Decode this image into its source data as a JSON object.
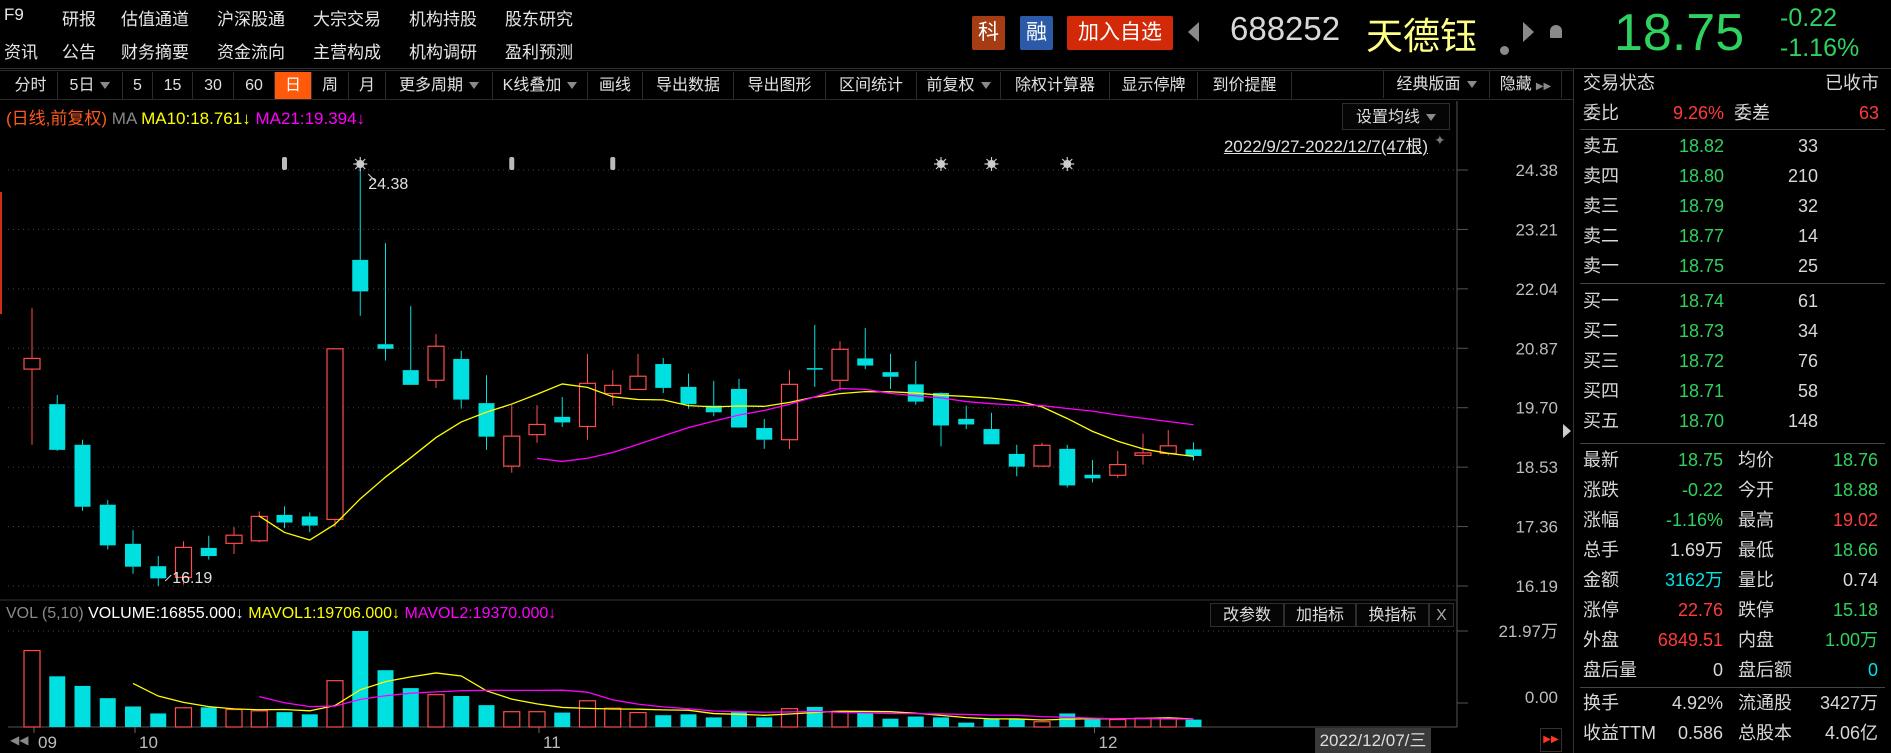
{
  "menu": {
    "row1": [
      "F9",
      "研报",
      "估值通道",
      "沪深股通",
      "大宗交易",
      "机构持股",
      "股东研究"
    ],
    "row2": [
      "资讯",
      "公告",
      "财务摘要",
      "资金流向",
      "主营构成",
      "机构调研",
      "盈利预测"
    ]
  },
  "header": {
    "badge_ke": "科",
    "badge_rong": "融",
    "add_watchlist": "加入自选",
    "code": "688252",
    "name": "天德钰",
    "price": "18.75",
    "change": "-0.22",
    "change_pct": "-1.16%"
  },
  "toolbar": {
    "items": [
      "分时",
      "5日",
      "5",
      "15",
      "30",
      "60",
      "日",
      "周",
      "月",
      "更多周期",
      "K线叠加",
      "画线",
      "导出数据",
      "导出图形",
      "区间统计",
      "前复权",
      "除权计算器",
      "显示停牌",
      "到价提醒"
    ],
    "selected": "日",
    "layout": "经典版面",
    "hide": "隐藏"
  },
  "chart_legend": {
    "mode": "(日线,前复权)",
    "ma": "MA",
    "ma10": "MA10:18.761↓",
    "ma21": "MA21:19.394↓"
  },
  "chart_controls": {
    "set_ma": "设置均线",
    "range": "2022/9/27-2022/12/7(47根)"
  },
  "volume_legend": {
    "name": "VOL (5,10)",
    "volume": "VOLUME:16855.000↓",
    "mavol1": "MAVOL1:19706.000↓",
    "mavol2": "MAVOL2:19370.000↓",
    "buttons": [
      "改参数",
      "加指标",
      "换指标",
      "X"
    ]
  },
  "colors": {
    "up": "#ff4c4c",
    "down": "#00e0e0",
    "ma10": "#ffff00",
    "ma21": "#ff00ff",
    "green": "#2fd15f",
    "red": "#ff3b3b"
  },
  "chart_data": {
    "type": "candlestick",
    "title": "688252 天德钰 日线 前复权",
    "price_ticks": [
      "24.38",
      "23.21",
      "22.04",
      "20.87",
      "19.70",
      "18.53",
      "17.36",
      "16.19"
    ],
    "ylim": [
      16.19,
      24.38
    ],
    "annotations": {
      "high": "24.38",
      "low": "16.19",
      "high_index": 13,
      "low_index": 5
    },
    "event_markers": [
      {
        "index": 10,
        "type": "info"
      },
      {
        "index": 13,
        "type": "star"
      },
      {
        "index": 19,
        "type": "info"
      },
      {
        "index": 23,
        "type": "info"
      },
      {
        "index": 36,
        "type": "star"
      },
      {
        "index": 38,
        "type": "star"
      },
      {
        "index": 41,
        "type": "star"
      }
    ],
    "month_labels": [
      {
        "index": 0,
        "label": "09"
      },
      {
        "index": 4,
        "label": "10"
      },
      {
        "index": 20,
        "label": "11"
      },
      {
        "index": 42,
        "label": "12"
      }
    ],
    "open": [
      20.46,
      19.77,
      18.97,
      17.79,
      17.02,
      16.58,
      16.36,
      16.94,
      17.03,
      17.08,
      17.59,
      17.56,
      17.5,
      22.61,
      20.95,
      20.44,
      20.24,
      20.66,
      19.79,
      18.55,
      19.17,
      19.52,
      19.33,
      19.98,
      20.06,
      20.56,
      20.11,
      19.74,
      20.07,
      19.3,
      19.07,
      20.48,
      20.24,
      20.67,
      20.4,
      20.16,
      19.99,
      19.48,
      19.28,
      18.79,
      18.55,
      18.89,
      18.38,
      18.37,
      18.76,
      18.8,
      18.88
    ],
    "high": [
      21.66,
      19.95,
      19.07,
      17.88,
      17.29,
      16.78,
      17.07,
      17.18,
      17.35,
      17.66,
      17.76,
      17.64,
      20.86,
      24.38,
      22.94,
      21.7,
      21.15,
      20.82,
      20.34,
      19.75,
      19.75,
      19.91,
      20.76,
      20.44,
      20.76,
      20.68,
      20.37,
      20.23,
      20.27,
      19.48,
      20.44,
      21.33,
      21.01,
      21.27,
      20.76,
      20.62,
      20.0,
      19.74,
      19.6,
      18.97,
      19.01,
      18.97,
      18.67,
      18.85,
      19.19,
      19.26,
      19.02
    ],
    "low": [
      18.97,
      18.85,
      17.67,
      16.91,
      16.43,
      16.19,
      16.22,
      16.71,
      16.82,
      17.05,
      17.33,
      17.25,
      17.35,
      21.51,
      20.63,
      20.15,
      20.09,
      19.68,
      18.87,
      18.42,
      19.01,
      19.32,
      19.07,
      19.74,
      20.06,
      19.99,
      19.68,
      19.53,
      19.31,
      18.89,
      18.89,
      20.11,
      20.04,
      20.46,
      20.07,
      19.76,
      18.94,
      19.28,
      18.98,
      18.35,
      18.55,
      18.13,
      18.23,
      18.32,
      18.58,
      18.76,
      18.66
    ],
    "close": [
      20.67,
      18.87,
      17.75,
      16.99,
      16.57,
      16.34,
      16.95,
      16.78,
      17.19,
      17.56,
      17.44,
      17.38,
      20.86,
      21.99,
      20.86,
      20.15,
      20.91,
      19.86,
      19.13,
      19.14,
      19.37,
      19.41,
      20.18,
      20.14,
      20.32,
      20.09,
      19.77,
      19.61,
      19.31,
      19.07,
      20.16,
      20.45,
      20.85,
      20.53,
      20.31,
      19.82,
      19.35,
      19.37,
      18.98,
      18.54,
      18.96,
      18.17,
      18.31,
      18.58,
      18.81,
      18.95,
      18.75
    ],
    "ma_periods": [
      10,
      21
    ],
    "volume_unit": "万",
    "volume": [
      17.5,
      11.6,
      9.4,
      6.6,
      4.7,
      3.1,
      4.4,
      4.5,
      4.0,
      3.7,
      3.4,
      2.9,
      10.6,
      21.97,
      13.0,
      8.9,
      7.4,
      7.1,
      5.0,
      3.5,
      3.5,
      3.3,
      6.0,
      4.3,
      3.3,
      2.7,
      2.9,
      2.2,
      3.4,
      2.2,
      4.2,
      4.6,
      3.6,
      3.2,
      1.9,
      2.4,
      2.2,
      1.0,
      1.8,
      1.8,
      1.2,
      3.1,
      1.7,
      1.7,
      2.0,
      2.0,
      1.69
    ],
    "volume_ticks": [
      "21.97万",
      "0.00"
    ],
    "volume_max": 21.97,
    "vol_ma_periods": [
      5,
      10
    ],
    "current_date": "2022/12/07/三"
  },
  "quote_panel": {
    "status_label": "交易状态",
    "status_value": "已收市",
    "wb_label": "委比",
    "wb_value": "9.26%",
    "wc_label": "委差",
    "wc_value": "63",
    "asks": [
      {
        "label": "卖五",
        "price": "18.82",
        "qty": "33"
      },
      {
        "label": "卖四",
        "price": "18.80",
        "qty": "210"
      },
      {
        "label": "卖三",
        "price": "18.79",
        "qty": "32"
      },
      {
        "label": "卖二",
        "price": "18.77",
        "qty": "14"
      },
      {
        "label": "卖一",
        "price": "18.75",
        "qty": "25"
      }
    ],
    "bids": [
      {
        "label": "买一",
        "price": "18.74",
        "qty": "61"
      },
      {
        "label": "买二",
        "price": "18.73",
        "qty": "34"
      },
      {
        "label": "买三",
        "price": "18.72",
        "qty": "76"
      },
      {
        "label": "买四",
        "price": "18.71",
        "qty": "58"
      },
      {
        "label": "买五",
        "price": "18.70",
        "qty": "148"
      }
    ],
    "stats": [
      {
        "l1": "最新",
        "v1": "18.75",
        "c1": "g",
        "l2": "均价",
        "v2": "18.76",
        "c2": "g"
      },
      {
        "l1": "涨跌",
        "v1": "-0.22",
        "c1": "g",
        "l2": "今开",
        "v2": "18.88",
        "c2": "g"
      },
      {
        "l1": "涨幅",
        "v1": "-1.16%",
        "c1": "g",
        "l2": "最高",
        "v2": "19.02",
        "c2": "r"
      },
      {
        "l1": "总手",
        "v1": "1.69万",
        "c1": "w",
        "l2": "最低",
        "v2": "18.66",
        "c2": "g"
      },
      {
        "l1": "金额",
        "v1": "3162万",
        "c1": "c",
        "l2": "量比",
        "v2": "0.74",
        "c2": "w"
      },
      {
        "l1": "涨停",
        "v1": "22.76",
        "c1": "r",
        "l2": "跌停",
        "v2": "15.18",
        "c2": "g"
      },
      {
        "l1": "外盘",
        "v1": "6849.51",
        "c1": "r",
        "l2": "内盘",
        "v2": "1.00万",
        "c2": "g"
      },
      {
        "l1": "盘后量",
        "v1": "0",
        "c1": "w",
        "l2": "盘后额",
        "v2": "0",
        "c2": "c"
      }
    ],
    "extra": [
      {
        "l1": "换手",
        "v1": "4.92%",
        "l2": "流通股",
        "v2": "3427万"
      },
      {
        "l1": "收益TTM",
        "v1": "0.586",
        "l2": "总股本",
        "v2": "4.06亿"
      }
    ]
  }
}
